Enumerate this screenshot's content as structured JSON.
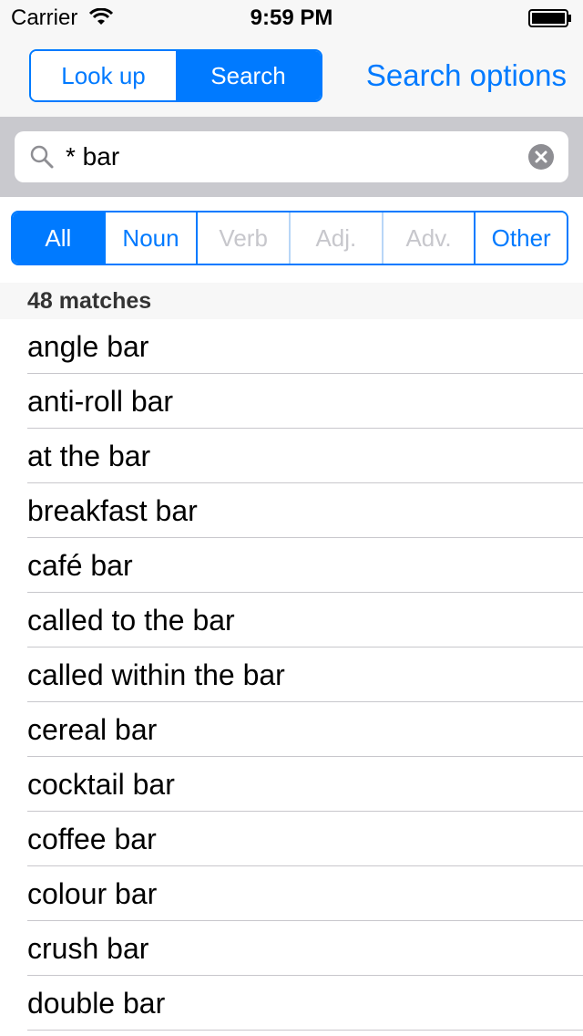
{
  "status_bar": {
    "carrier": "Carrier",
    "time": "9:59 PM"
  },
  "nav": {
    "segments": [
      {
        "label": "Look up",
        "selected": false
      },
      {
        "label": "Search",
        "selected": true
      }
    ],
    "search_options_label": "Search options"
  },
  "search": {
    "query": "* bar"
  },
  "filters": [
    {
      "label": "All",
      "state": "selected"
    },
    {
      "label": "Noun",
      "state": "enabled"
    },
    {
      "label": "Verb",
      "state": "disabled"
    },
    {
      "label": "Adj.",
      "state": "disabled"
    },
    {
      "label": "Adv.",
      "state": "disabled"
    },
    {
      "label": "Other",
      "state": "enabled"
    }
  ],
  "results": {
    "count_label": "48 matches",
    "items": [
      "angle bar",
      "anti-roll bar",
      "at the bar",
      "breakfast bar",
      "café bar",
      "called to the bar",
      "called within the bar",
      "cereal bar",
      "cocktail bar",
      "coffee bar",
      "colour bar",
      "crush bar",
      "double bar"
    ]
  },
  "colors": {
    "accent": "#007aff",
    "disabled": "#c7c7cc",
    "bar_bg": "#f7f7f7",
    "search_bg": "#c9c9ce"
  },
  "icons": [
    "wifi-icon",
    "battery-icon",
    "search-icon",
    "clear-icon"
  ]
}
